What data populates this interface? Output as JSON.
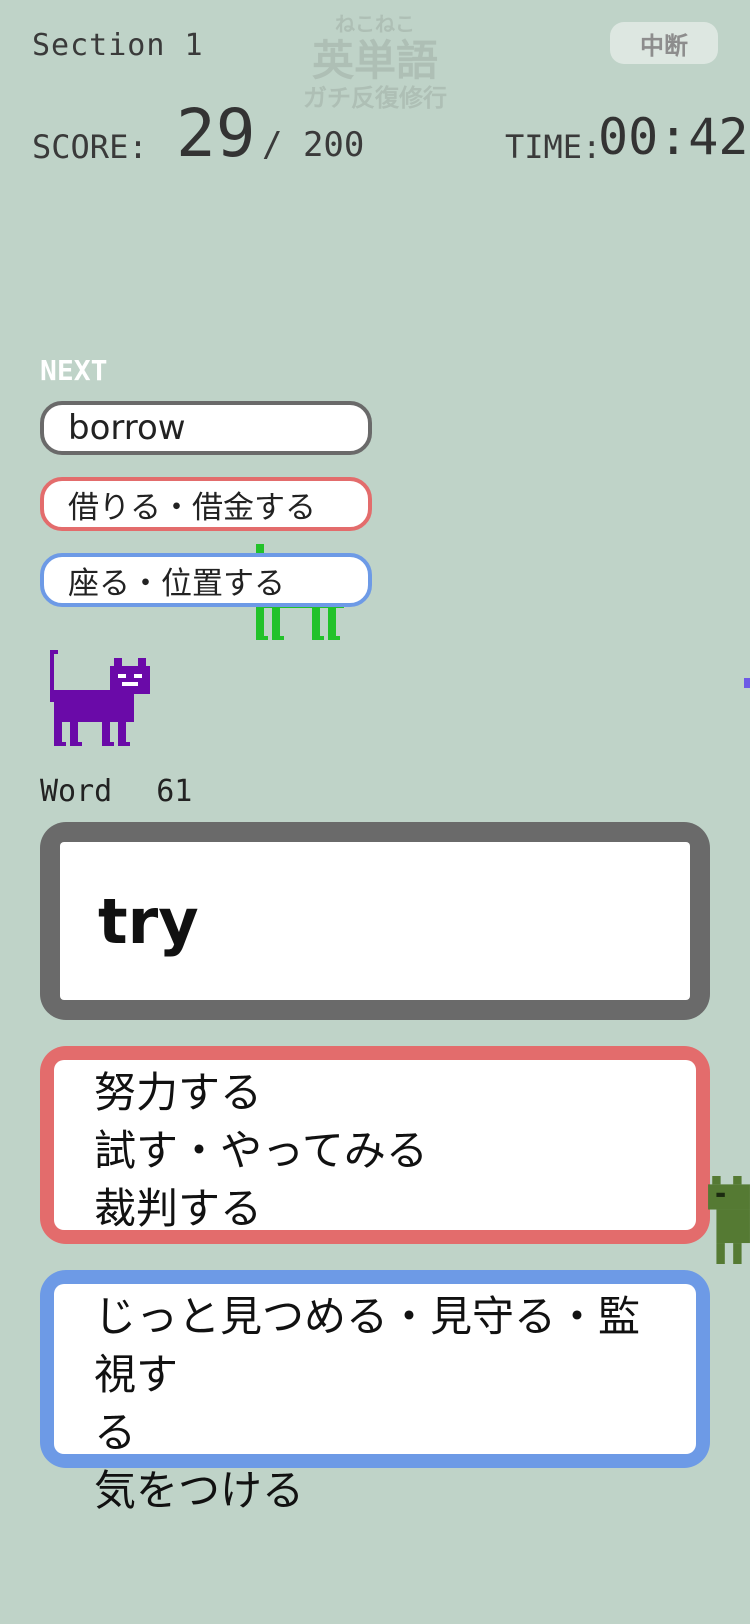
{
  "header": {
    "section": "Section 1",
    "logo": {
      "line1": "ねこねこ",
      "line2": "英単語",
      "line3": "ガチ反復修行"
    },
    "pause_label": "中断",
    "score_label": "SCORE:",
    "score": "29",
    "score_total": "/ 200",
    "time_label": "TIME:",
    "time": "00:42"
  },
  "next": {
    "label": "NEXT",
    "word": "borrow",
    "correct": "借りる・借金する",
    "wrong": "座る・位置する"
  },
  "word_label": "Word",
  "word_count": "61",
  "word": "try",
  "choices": {
    "red": [
      "努力する",
      "試す・やってみる",
      "裁判する"
    ],
    "blue": [
      "じっと見つめる・見守る・監視す",
      "る",
      "気をつける"
    ]
  },
  "colors": {
    "background": "#bfd3c8",
    "red": "#e36c6c",
    "blue": "#6d9ae6",
    "gray": "#6a6a6a",
    "cat_purple": "#6a0aa8",
    "cat_green": "#22c22a",
    "cat_olive": "#557a33"
  }
}
